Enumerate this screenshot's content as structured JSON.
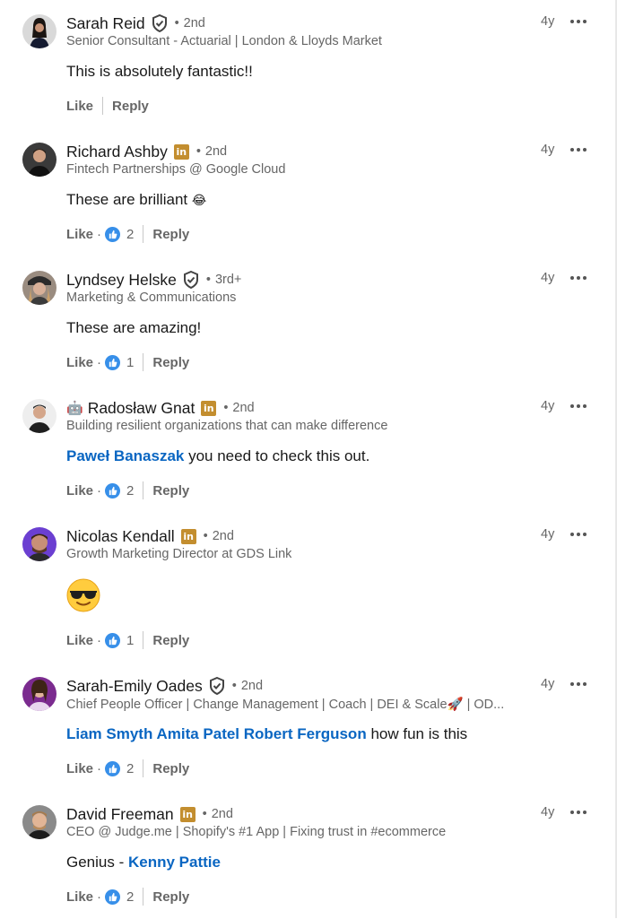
{
  "comments": [
    {
      "author": "Sarah Reid",
      "badge": "verified-shield-icon",
      "degree": "2nd",
      "headline": "Senior Consultant - Actuarial | London & Lloyds Market",
      "time": "4y",
      "text": "This is absolutely fantastic!!",
      "like": "Like",
      "reply": "Reply",
      "reactions": ""
    },
    {
      "author": "Richard Ashby",
      "badge": "linkedin-premium-icon",
      "degree": "2nd",
      "headline": "Fintech Partnerships @ Google Cloud",
      "time": "4y",
      "text": "These are brilliant",
      "text_emoji": "😂",
      "like": "Like",
      "reply": "Reply",
      "reactions": "2"
    },
    {
      "author": "Lyndsey Helske",
      "badge": "verified-shield-icon",
      "degree": "3rd+",
      "headline": "Marketing & Communications",
      "time": "4y",
      "text": "These are amazing!",
      "like": "Like",
      "reply": "Reply",
      "reactions": "1"
    },
    {
      "author_emoji": "🤖",
      "author": "Radosław Gnat",
      "badge": "linkedin-premium-icon",
      "degree": "2nd",
      "headline": "Building resilient organizations that can make difference",
      "time": "4y",
      "mention": "Paweł Banaszak",
      "text": "you need to check this out.",
      "like": "Like",
      "reply": "Reply",
      "reactions": "2"
    },
    {
      "author": "Nicolas Kendall",
      "badge": "linkedin-premium-icon",
      "degree": "2nd",
      "headline": "Growth Marketing Director at GDS Link",
      "time": "4y",
      "emoji_only": "😎",
      "like": "Like",
      "reply": "Reply",
      "reactions": "1"
    },
    {
      "author": "Sarah-Emily Oades",
      "badge": "verified-shield-icon",
      "degree": "2nd",
      "headline": "Chief People Officer | Change Management | Coach | DEI & Scale🚀 | OD...",
      "time": "4y",
      "mention": "Liam Smyth Amita Patel Robert Ferguson",
      "text": "how fun is this",
      "like": "Like",
      "reply": "Reply",
      "reactions": "2"
    },
    {
      "author": "David Freeman",
      "badge": "linkedin-premium-icon",
      "degree": "2nd",
      "headline": "CEO @ Judge.me | Shopify's #1 App | Fixing trust in #ecommerce",
      "time": "4y",
      "text": "Genius -",
      "mention_after": "Kenny Pattie",
      "like": "Like",
      "reply": "Reply",
      "reactions": "2"
    }
  ],
  "separator_dot": "•",
  "action_dot": "·",
  "colors": {
    "mention": "#0a66c2",
    "reaction_blue": "#378fe9",
    "premium_gold": "#c38e2f",
    "muted": "#666666"
  }
}
